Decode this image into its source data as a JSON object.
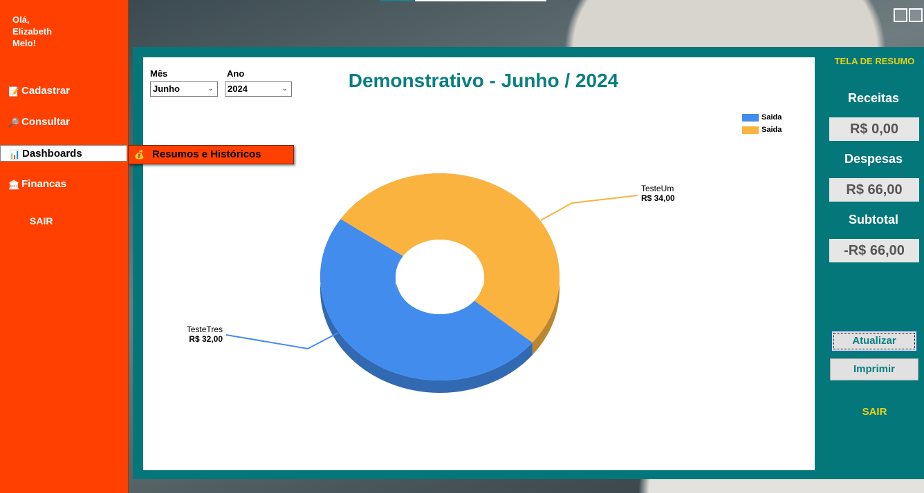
{
  "sidebar": {
    "greeting": [
      "Olá,",
      "Elizabeth",
      "Melo!"
    ],
    "items": [
      {
        "label": "Cadastrar",
        "icon": "register-icon"
      },
      {
        "label": "Consultar",
        "icon": "search-list-icon"
      },
      {
        "label": "Dashboards",
        "icon": "chart-icon"
      },
      {
        "label": "Financas",
        "icon": "bank-icon"
      }
    ],
    "exit_label": "SAIR",
    "submenu_label": "Resumos e Históricos"
  },
  "filters": {
    "month_label": "Mês",
    "month_value": "Junho",
    "year_label": "Ano",
    "year_value": "2024"
  },
  "summary": {
    "title": "TELA DE RESUMO",
    "revenue_label": "Receitas",
    "revenue_value": "R$ 0,00",
    "expenses_label": "Despesas",
    "expenses_value": "R$ 66,00",
    "subtotal_label": "Subtotal",
    "subtotal_value": "-R$ 66,00",
    "refresh_label": "Atualizar",
    "print_label": "Imprimir",
    "exit_label": "SAIR"
  },
  "colors": {
    "sidebar": "#ff4000",
    "panel": "#03777a",
    "accent_yellow": "#e6d21a",
    "slice_blue": "#428cee",
    "slice_orange": "#fbb33f"
  },
  "chart_data": {
    "type": "pie",
    "title": "Demonstrativo - Junho / 2024",
    "style": "3d-doughnut",
    "legend_position": "top-right",
    "slices": [
      {
        "label": "TesteUm",
        "value": 34.0,
        "value_label": "R$ 34,00",
        "legend": "Saida",
        "color": "#fbb33f"
      },
      {
        "label": "TesteTres",
        "value": 32.0,
        "value_label": "R$ 32,00",
        "legend": "Saida",
        "color": "#428cee"
      }
    ]
  }
}
